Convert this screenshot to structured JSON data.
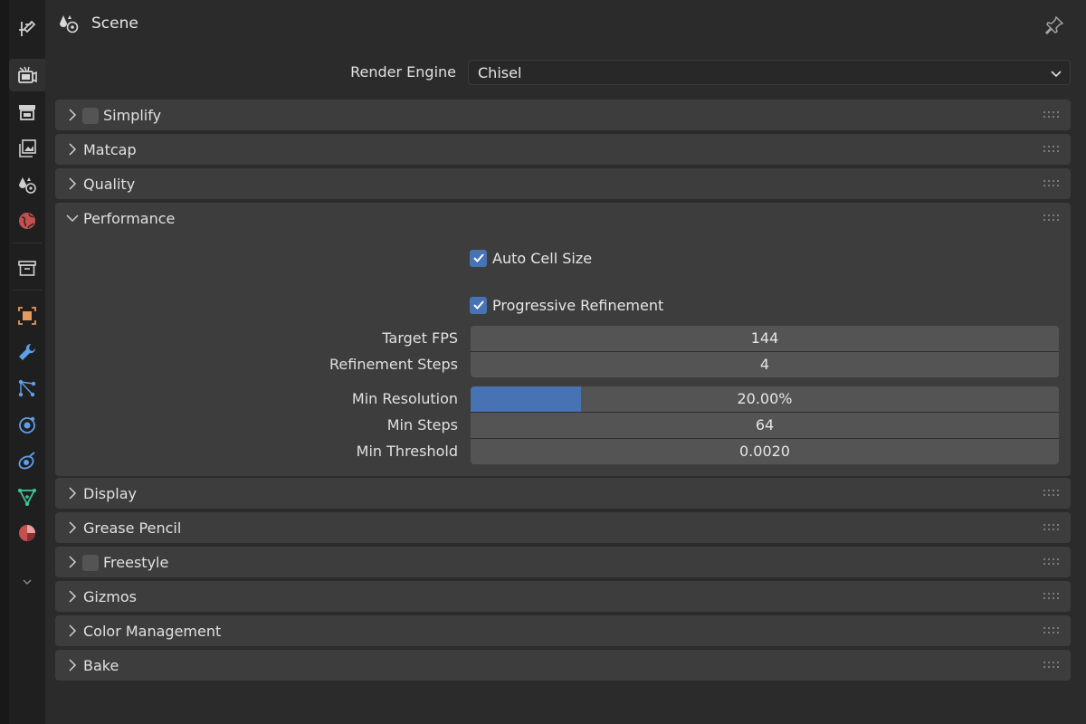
{
  "header": {
    "title": "Scene"
  },
  "render_engine": {
    "label": "Render Engine",
    "value": "Chisel"
  },
  "panels": {
    "simplify": {
      "label": "Simplify",
      "enabled": false
    },
    "matcap": {
      "label": "Matcap"
    },
    "quality": {
      "label": "Quality"
    },
    "performance": {
      "label": "Performance",
      "auto_cell_size": {
        "label": "Auto Cell Size",
        "checked": true
      },
      "progressive_refinement": {
        "label": "Progressive Refinement",
        "checked": true
      },
      "target_fps": {
        "label": "Target FPS",
        "value": "144"
      },
      "refinement_steps": {
        "label": "Refinement Steps",
        "value": "4"
      },
      "min_resolution": {
        "label": "Min Resolution",
        "value": "20.00%",
        "fraction": 0.2
      },
      "min_steps": {
        "label": "Min Steps",
        "value": "64"
      },
      "min_threshold": {
        "label": "Min Threshold",
        "value": "0.0020"
      }
    },
    "display": {
      "label": "Display"
    },
    "grease_pencil": {
      "label": "Grease Pencil"
    },
    "freestyle": {
      "label": "Freestyle",
      "enabled": false
    },
    "gizmos": {
      "label": "Gizmos"
    },
    "color_management": {
      "label": "Color Management"
    },
    "bake": {
      "label": "Bake"
    }
  },
  "colors": {
    "accent": "#4772b3",
    "background": "#2b2b2b",
    "panel": "#3d3d3d",
    "field": "#545454"
  },
  "tabs": [
    "tool-icon",
    "render-icon",
    "output-icon",
    "view-layer-icon",
    "scene-icon",
    "world-icon",
    "collection-icon",
    "object-icon",
    "modifier-icon",
    "particles-icon",
    "physics-icon",
    "constraints-icon",
    "data-icon",
    "material-icon",
    "expand-chevron-icon"
  ]
}
